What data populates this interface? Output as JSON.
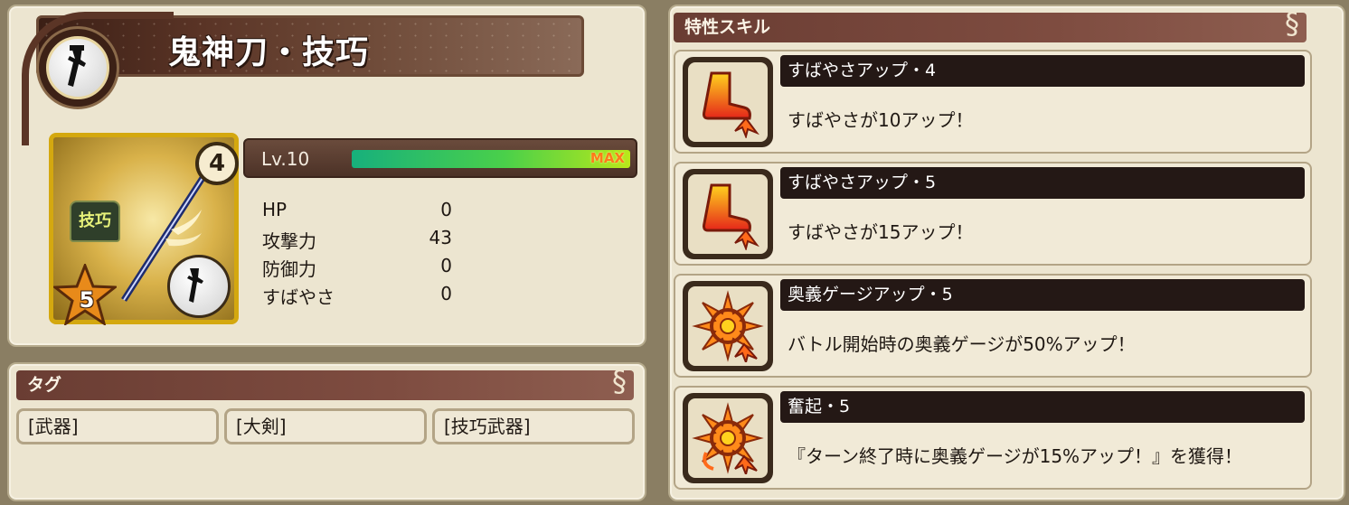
{
  "weapon": {
    "name": "鬼神刀・技巧",
    "card": {
      "number": "4",
      "tag": "技巧",
      "rarity_stars": "5"
    },
    "level_label": "Lv.10",
    "gauge_fraction": 1.0,
    "gauge_label": "MAX",
    "stats": [
      {
        "label": "HP",
        "value": "0"
      },
      {
        "label": "攻撃力",
        "value": "43"
      },
      {
        "label": "防御力",
        "value": "0"
      },
      {
        "label": "すばやさ",
        "value": "0"
      }
    ]
  },
  "tags": {
    "header": "タグ",
    "items": [
      "[武器]",
      "[大剣]",
      "[技巧武器]"
    ]
  },
  "skills": {
    "header": "特性スキル",
    "items": [
      {
        "icon": "boot-icon",
        "title": "すばやさアップ・4",
        "desc": "すばやさが10アップ！"
      },
      {
        "icon": "boot-icon",
        "title": "すばやさアップ・5",
        "desc": "すばやさが15アップ！"
      },
      {
        "icon": "burst-icon",
        "title": "奥義ゲージアップ・5",
        "desc": "バトル開始時の奥義ゲージが50%アップ！"
      },
      {
        "icon": "burst-icon",
        "title": "奮起・5",
        "desc": "『ターン終了時に奥義ゲージが15%アップ！』を獲得！"
      }
    ]
  },
  "colors": {
    "panel": "#ece5d0",
    "header": "#7e4c40",
    "gauge_max_text": "#ff7a1a"
  }
}
